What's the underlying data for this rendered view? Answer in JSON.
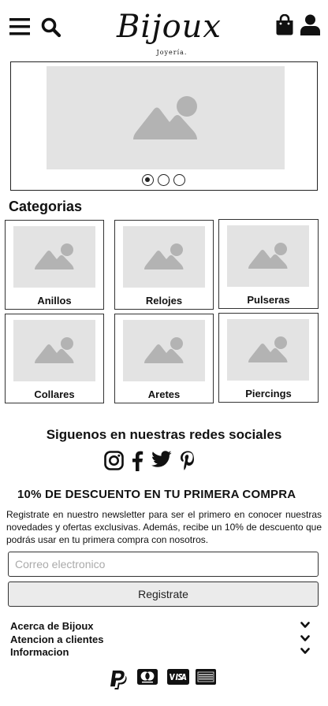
{
  "header": {
    "menu_icon": "hamburger-menu-icon",
    "search_icon": "search-icon",
    "logo_text": "Bijoux",
    "logo_subtitle": "Joyería.",
    "cart_icon": "shopping-bag-icon",
    "account_icon": "user-icon"
  },
  "hero": {
    "image_icon": "image-placeholder-icon",
    "slides": 3,
    "active_slide": 1
  },
  "categories": {
    "title": "Categorias",
    "items": [
      {
        "label": "Anillos"
      },
      {
        "label": "Relojes"
      },
      {
        "label": "Pulseras"
      },
      {
        "label": "Collares"
      },
      {
        "label": "Aretes"
      },
      {
        "label": "Piercings"
      }
    ]
  },
  "social": {
    "title": "Siguenos en nuestras redes sociales",
    "icons": [
      "instagram-icon",
      "facebook-icon",
      "twitter-icon",
      "pinterest-icon"
    ]
  },
  "promo": {
    "title": "10% DE DESCUENTO EN TU PRIMERA COMPRA",
    "text": "Registrate en nuestro newsletter para ser el primero en conocer nuestras novedades y ofertas exclusivas. Además, recibe un 10% de descuento que podrás usar en tu primera compra con nosotros.",
    "email_placeholder": "Correo electronico",
    "button_label": "Registrate"
  },
  "footer": {
    "sections": [
      {
        "label": "Acerca de Bijoux"
      },
      {
        "label": "Atencion a clientes"
      },
      {
        "label": "Informacion"
      }
    ],
    "payment_icons": [
      "paypal-icon",
      "mastercard-icon",
      "visa-icon",
      "american-express-icon"
    ]
  },
  "colors": {
    "placeholder_bg": "#e3e3e3",
    "placeholder_icon": "#b3b3b3",
    "text": "#111111",
    "button_bg": "#ebebeb"
  }
}
